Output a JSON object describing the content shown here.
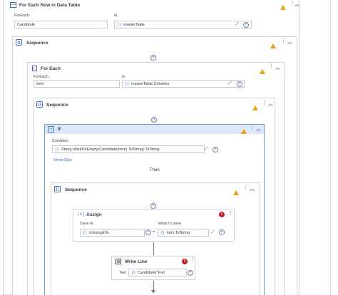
{
  "for_each_row": {
    "title": "For Each Row in Data Table",
    "foreach_label": "ForEach",
    "foreach_value": "Candidate",
    "in_label": "in",
    "in_value": "masterTable"
  },
  "outer_sequence": {
    "title": "Sequence"
  },
  "for_each": {
    "title": "For Each",
    "foreach_label": "ForEach",
    "foreach_value": "item",
    "in_label": "In",
    "in_value": "masterTable.Columns"
  },
  "inner_sequence": {
    "title": "Sequence"
  },
  "if_activity": {
    "title": "If",
    "condition_label": "Condition",
    "condition_value": "String.IsNullOrEmpty(Candidate(item).ToString).ToString",
    "show_else": "Show Else",
    "then_label": "Then"
  },
  "then_sequence": {
    "title": "Sequence"
  },
  "assign": {
    "title": "Assign",
    "save_to_label": "Save to",
    "save_to_value": "missingInfo",
    "value_label": "Value to save",
    "value_value": "item.ToString",
    "equals": "="
  },
  "write_line": {
    "title": "Write Line",
    "text_label": "Text",
    "text_value": "Candidate(\"Full"
  },
  "icons": {
    "brace": "{}",
    "plus": "+",
    "expand": "⤢",
    "collapse": "⌃",
    "error": "!"
  },
  "colors": {
    "warning": "#e6a31a",
    "error": "#c8202a",
    "selected_border": "#6b9bd6",
    "link": "#2f6fc4"
  }
}
